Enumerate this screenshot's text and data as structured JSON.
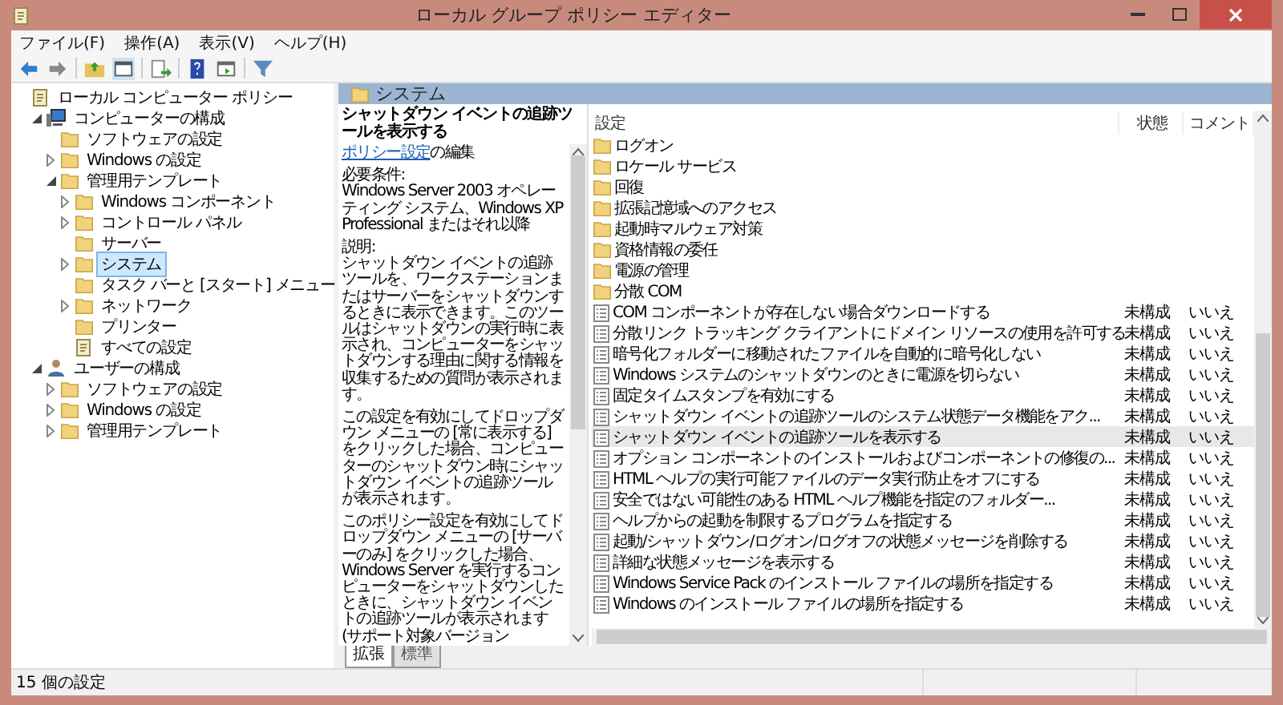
{
  "window": {
    "title": "ローカル グループ ポリシー エディター"
  },
  "menu": [
    "ファイル(F)",
    "操作(A)",
    "表示(V)",
    "ヘルプ(H)"
  ],
  "tree": [
    {
      "label": "ローカル コンピューター ポリシー",
      "kind": "policy",
      "selected": false,
      "children": [
        {
          "label": "コンピューターの構成",
          "kind": "computer",
          "expanded": true,
          "selected": false,
          "children": [
            {
              "label": "ソフトウェアの設定",
              "kind": "folder",
              "selected": false
            },
            {
              "label": "Windows の設定",
              "kind": "folder",
              "expanded": false,
              "selected": false
            },
            {
              "label": "管理用テンプレート",
              "kind": "folder",
              "expanded": true,
              "selected": false,
              "children": [
                {
                  "label": "Windows コンポーネント",
                  "kind": "folder",
                  "expanded": false,
                  "selected": false
                },
                {
                  "label": "コントロール パネル",
                  "kind": "folder",
                  "expanded": false,
                  "selected": false
                },
                {
                  "label": "サーバー",
                  "kind": "folder",
                  "selected": false
                },
                {
                  "label": "システム",
                  "kind": "folder",
                  "expanded": false,
                  "selected": true
                },
                {
                  "label": "タスク バーと [スタート] メニュー",
                  "kind": "folder",
                  "selected": false
                },
                {
                  "label": "ネットワーク",
                  "kind": "folder",
                  "expanded": false,
                  "selected": false
                },
                {
                  "label": "プリンター",
                  "kind": "folder",
                  "selected": false
                },
                {
                  "label": "すべての設定",
                  "kind": "policy",
                  "selected": false
                }
              ]
            }
          ]
        },
        {
          "label": "ユーザーの構成",
          "kind": "user",
          "expanded": true,
          "selected": false,
          "children": [
            {
              "label": "ソフトウェアの設定",
              "kind": "folder",
              "expanded": false,
              "selected": false
            },
            {
              "label": "Windows の設定",
              "kind": "folder",
              "expanded": false,
              "selected": false
            },
            {
              "label": "管理用テンプレート",
              "kind": "folder",
              "expanded": false,
              "selected": false
            }
          ]
        }
      ]
    }
  ],
  "header": {
    "title": "システム"
  },
  "description": {
    "title": "シャットダウン イベントの追跡ツールを表示する",
    "link": "ポリシー設定",
    "link_suffix": "の編集",
    "paragraphs": [
      "必要条件:\nWindows Server 2003 オペレーティング システム、Windows XP Professional またはそれ以降",
      "説明:\nシャットダウン イベントの追跡ツールを、ワークステーションまたはサーバーをシャットダウンするときに表示できます。このツールはシャットダウンの実行時に表示され、コンピューターをシャットダウンする理由に関する情報を収集するための質問が表示されます。",
      "この設定を有効にしてドロップダウン メニューの [常に表示する] をクリックした場合、コンピューターのシャットダウン時にシャットダウン イベントの追跡ツールが表示されます。",
      "このポリシー設定を有効にしてドロップダウン メニューの [サーバーのみ] をクリックした場合、Windows Server を実行するコンピューターをシャットダウンしたときに、シャットダウン イベントの追跡ツールが表示されます(サポート対象バージョン"
    ]
  },
  "table": {
    "columns": [
      "設定",
      "状態",
      "コメント"
    ],
    "rows": [
      {
        "kind": "folder",
        "name": "ログオン",
        "selected": false
      },
      {
        "kind": "folder",
        "name": "ロケール サービス",
        "selected": false
      },
      {
        "kind": "folder",
        "name": "回復",
        "selected": false
      },
      {
        "kind": "folder",
        "name": "拡張記憶域へのアクセス",
        "selected": false
      },
      {
        "kind": "folder",
        "name": "起動時マルウェア対策",
        "selected": false
      },
      {
        "kind": "folder",
        "name": "資格情報の委任",
        "selected": false
      },
      {
        "kind": "folder",
        "name": "電源の管理",
        "selected": false
      },
      {
        "kind": "folder",
        "name": "分散 COM",
        "selected": false
      },
      {
        "kind": "setting",
        "name": "COM コンポーネントが存在しない場合ダウンロードする",
        "state": "未構成",
        "comment": "いいえ",
        "selected": false
      },
      {
        "kind": "setting",
        "name": "分散リンク トラッキング クライアントにドメイン リソースの使用を許可する",
        "state": "未構成",
        "comment": "いいえ",
        "selected": false
      },
      {
        "kind": "setting",
        "name": "暗号化フォルダーに移動されたファイルを自動的に暗号化しない",
        "state": "未構成",
        "comment": "いいえ",
        "selected": false
      },
      {
        "kind": "setting",
        "name": "Windows システムのシャットダウンのときに電源を切らない",
        "state": "未構成",
        "comment": "いいえ",
        "selected": false
      },
      {
        "kind": "setting",
        "name": "固定タイムスタンプを有効にする",
        "state": "未構成",
        "comment": "いいえ",
        "selected": false
      },
      {
        "kind": "setting",
        "name": "シャットダウン イベントの追跡ツールのシステム状態データ機能をアク...",
        "state": "未構成",
        "comment": "いいえ",
        "selected": false
      },
      {
        "kind": "setting",
        "name": "シャットダウン イベントの追跡ツールを表示する",
        "state": "未構成",
        "comment": "いいえ",
        "selected": true
      },
      {
        "kind": "setting",
        "name": "オプション コンポーネントのインストールおよびコンポーネントの修復の...",
        "state": "未構成",
        "comment": "いいえ",
        "selected": false
      },
      {
        "kind": "setting",
        "name": "HTML ヘルプの実行可能ファイルのデータ実行防止をオフにする",
        "state": "未構成",
        "comment": "いいえ",
        "selected": false
      },
      {
        "kind": "setting",
        "name": "安全ではない可能性のある HTML ヘルプ機能を指定のフォルダー...",
        "state": "未構成",
        "comment": "いいえ",
        "selected": false
      },
      {
        "kind": "setting",
        "name": "ヘルプからの起動を制限するプログラムを指定する",
        "state": "未構成",
        "comment": "いいえ",
        "selected": false
      },
      {
        "kind": "setting",
        "name": "起動/シャットダウン/ログオン/ログオフの状態メッセージを削除する",
        "state": "未構成",
        "comment": "いいえ",
        "selected": false
      },
      {
        "kind": "setting",
        "name": "詳細な状態メッセージを表示する",
        "state": "未構成",
        "comment": "いいえ",
        "selected": false
      },
      {
        "kind": "setting",
        "name": "Windows Service Pack のインストール ファイルの場所を指定する",
        "state": "未構成",
        "comment": "いいえ",
        "selected": false
      },
      {
        "kind": "setting",
        "name": "Windows のインストール ファイルの場所を指定する",
        "state": "未構成",
        "comment": "いいえ",
        "selected": false
      }
    ]
  },
  "view_tabs": [
    {
      "label": "拡張",
      "selected": true
    },
    {
      "label": "標準",
      "selected": false
    }
  ],
  "status_bar": {
    "text": "15 個の設定"
  }
}
